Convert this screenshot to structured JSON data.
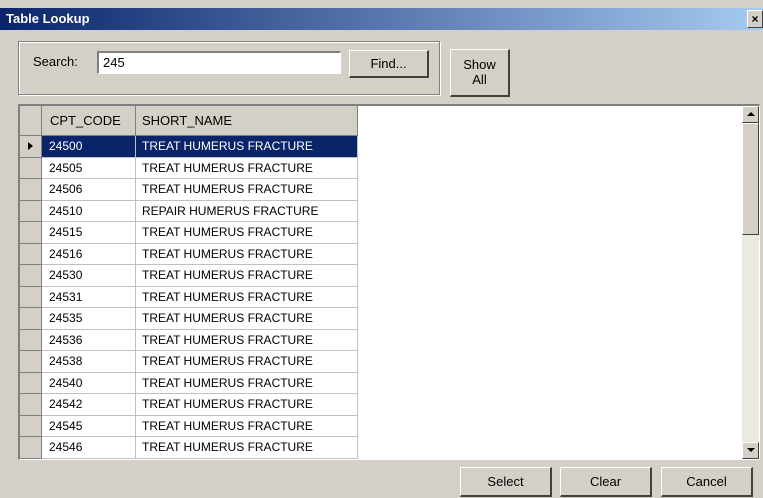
{
  "window": {
    "title": "Table Lookup",
    "close_glyph": "×"
  },
  "search": {
    "label": "Search:",
    "value": "245",
    "find_label": "Find...",
    "show_all_line1": "Show",
    "show_all_line2": "All"
  },
  "grid": {
    "columns": [
      "CPT_CODE",
      "SHORT_NAME"
    ],
    "selected_row": 0,
    "rows": [
      {
        "code": "24500",
        "name": "TREAT HUMERUS FRACTURE"
      },
      {
        "code": "24505",
        "name": "TREAT HUMERUS FRACTURE"
      },
      {
        "code": "24506",
        "name": "TREAT HUMERUS FRACTURE"
      },
      {
        "code": "24510",
        "name": "REPAIR HUMERUS FRACTURE"
      },
      {
        "code": "24515",
        "name": "TREAT HUMERUS FRACTURE"
      },
      {
        "code": "24516",
        "name": "TREAT HUMERUS FRACTURE"
      },
      {
        "code": "24530",
        "name": "TREAT HUMERUS FRACTURE"
      },
      {
        "code": "24531",
        "name": "TREAT HUMERUS FRACTURE"
      },
      {
        "code": "24535",
        "name": "TREAT HUMERUS FRACTURE"
      },
      {
        "code": "24536",
        "name": "TREAT HUMERUS FRACTURE"
      },
      {
        "code": "24538",
        "name": "TREAT HUMERUS FRACTURE"
      },
      {
        "code": "24540",
        "name": "TREAT HUMERUS FRACTURE"
      },
      {
        "code": "24542",
        "name": "TREAT HUMERUS FRACTURE"
      },
      {
        "code": "24545",
        "name": "TREAT HUMERUS FRACTURE"
      },
      {
        "code": "24546",
        "name": "TREAT HUMERUS FRACTURE"
      }
    ]
  },
  "buttons": {
    "select": "Select",
    "clear": "Clear",
    "cancel": "Cancel"
  },
  "colors": {
    "selection": "#0a246a",
    "face": "#d4d0c8"
  }
}
